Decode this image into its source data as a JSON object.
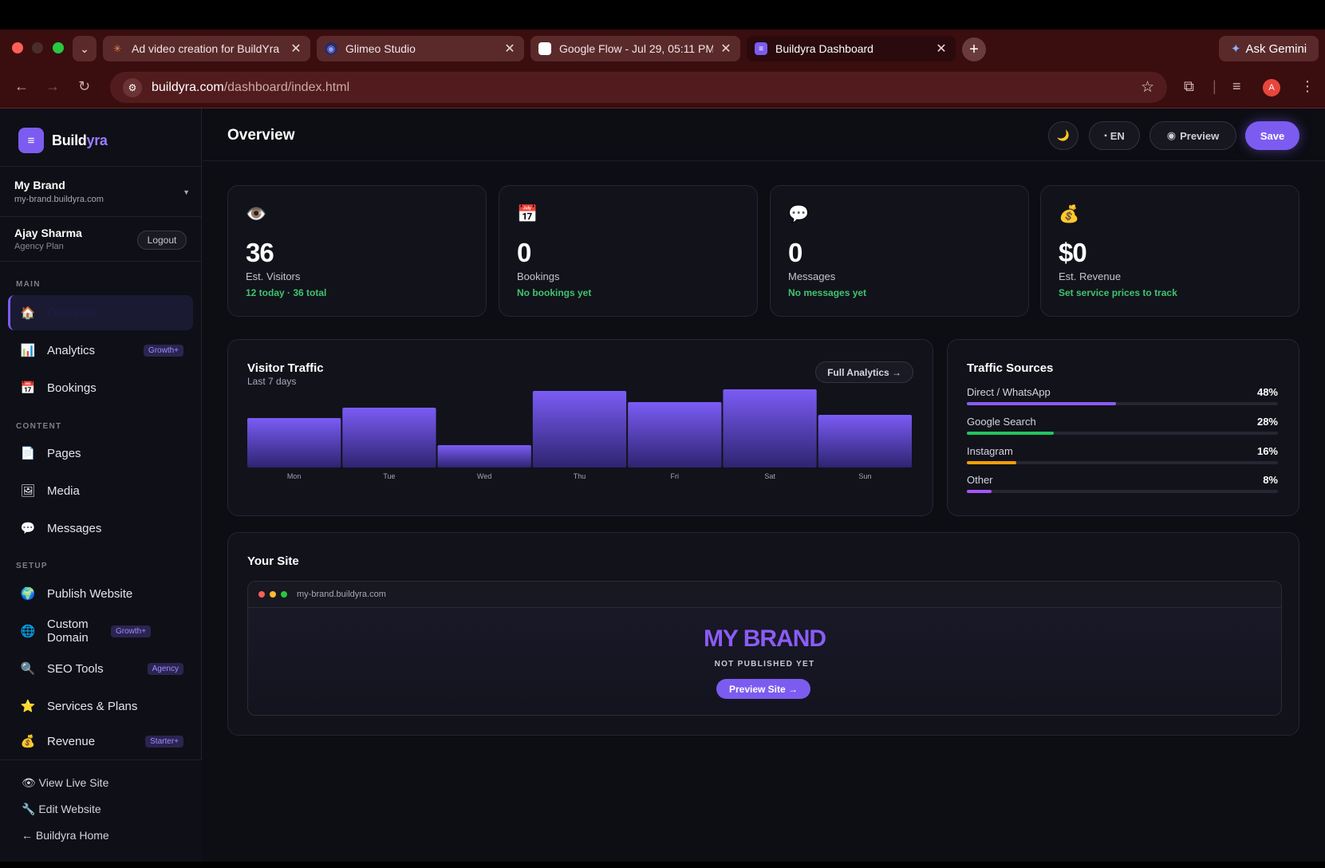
{
  "browser": {
    "tabs": [
      {
        "title": "Ad video creation for BuildYra",
        "favicon": "sparkle-icon"
      },
      {
        "title": "Glimeo Studio",
        "favicon": "glimeo-icon"
      },
      {
        "title": "Google Flow - Jul 29, 05:11 PM",
        "favicon": "page-icon"
      },
      {
        "title": "Buildyra Dashboard",
        "favicon": "buildyra-icon"
      }
    ],
    "ask_gemini": "Ask Gemini",
    "url_host": "buildyra.com",
    "url_path": "/dashboard/index.html",
    "profile_initial": "A"
  },
  "sidebar": {
    "logo_main": "Build",
    "logo_accent": "yra",
    "brand_name": "My Brand",
    "brand_url": "my-brand.buildyra.com",
    "user_name": "Ajay Sharma",
    "user_plan": "Agency Plan",
    "logout": "Logout",
    "sections": {
      "main": "MAIN",
      "content": "CONTENT",
      "setup": "SETUP"
    },
    "items": [
      {
        "label": "Overview",
        "icon": "🏠",
        "badge": ""
      },
      {
        "label": "Analytics",
        "icon": "📊",
        "badge": "Growth+"
      },
      {
        "label": "Bookings",
        "icon": "📅",
        "badge": ""
      },
      {
        "label": "Pages",
        "icon": "📄",
        "badge": ""
      },
      {
        "label": "Media",
        "icon": "🖼",
        "badge": ""
      },
      {
        "label": "Messages",
        "icon": "💬",
        "badge": ""
      },
      {
        "label": "Publish Website",
        "icon": "🌍",
        "badge": ""
      },
      {
        "label": "Custom Domain",
        "icon": "🌐",
        "badge": "Growth+"
      },
      {
        "label": "SEO Tools",
        "icon": "🔍",
        "badge": "Agency"
      },
      {
        "label": "Services & Plans",
        "icon": "⭐",
        "badge": ""
      },
      {
        "label": "Revenue",
        "icon": "💰",
        "badge": "Starter+"
      }
    ],
    "footer": [
      {
        "label": "View Live Site",
        "icon": "👁"
      },
      {
        "label": "Edit Website",
        "icon": "🔧"
      },
      {
        "label": "Buildyra Home",
        "icon": "←"
      }
    ]
  },
  "header": {
    "title": "Overview",
    "theme_icon": "🌙",
    "lang": "EN",
    "preview": "Preview",
    "save": "Save"
  },
  "stats": [
    {
      "icon": "👁️",
      "value": "36",
      "label": "Est. Visitors",
      "sub": "12 today · 36 total"
    },
    {
      "icon": "📅",
      "value": "0",
      "label": "Bookings",
      "sub": "No bookings yet"
    },
    {
      "icon": "💬",
      "value": "0",
      "label": "Messages",
      "sub": "No messages yet"
    },
    {
      "icon": "💰",
      "value": "$0",
      "label": "Est. Revenue",
      "sub": "Set service prices to track"
    }
  ],
  "traffic": {
    "title": "Visitor Traffic",
    "subtitle": "Last 7 days",
    "button": "Full Analytics →"
  },
  "chart_data": {
    "type": "bar",
    "categories": [
      "Mon",
      "Tue",
      "Wed",
      "Thu",
      "Fri",
      "Sat",
      "Sun"
    ],
    "values": [
      6.2,
      7.5,
      2.8,
      9.6,
      8.2,
      9.8,
      6.6
    ],
    "ylim": [
      0,
      10
    ],
    "colors": {
      "top": "#7b5cf5",
      "bottom": "#2e2470"
    }
  },
  "sources": {
    "title": "Traffic Sources",
    "items": [
      {
        "name": "Direct / WhatsApp",
        "pct": "48%",
        "value": 48,
        "color": "#8b5cf6"
      },
      {
        "name": "Google Search",
        "pct": "28%",
        "value": 28,
        "color": "#22c55e"
      },
      {
        "name": "Instagram",
        "pct": "16%",
        "value": 16,
        "color": "#f59e0b"
      },
      {
        "name": "Other",
        "pct": "8%",
        "value": 8,
        "color": "#a855f7"
      }
    ]
  },
  "site": {
    "title": "Your Site",
    "url": "my-brand.buildyra.com",
    "brand": "MY BRAND",
    "status": "NOT PUBLISHED YET",
    "button": "Preview Site →"
  }
}
